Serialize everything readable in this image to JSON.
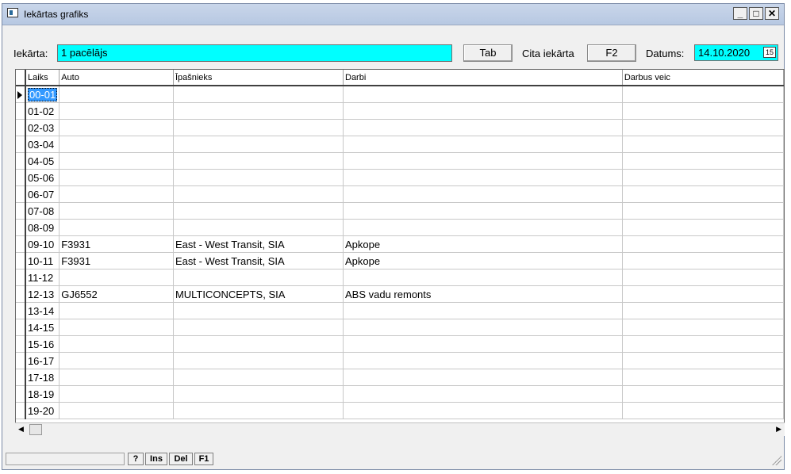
{
  "window": {
    "title": "Iekārtas grafiks",
    "controls": [
      "_",
      "□",
      "✕"
    ]
  },
  "header": {
    "iekarta_label": "Iekārta:",
    "iekarta_value": "1 pacēlājs",
    "tab_button": "Tab",
    "cita_label": "Cita iekārta",
    "f2_button": "F2",
    "datums_label": "Datums:",
    "datums_value": "14.10.2020"
  },
  "grid": {
    "columns": [
      "Laiks",
      "Auto",
      "Īpašnieks",
      "Darbi",
      "Darbus veic"
    ],
    "rows": [
      [
        "00-01",
        "",
        "",
        "",
        ""
      ],
      [
        "01-02",
        "",
        "",
        "",
        ""
      ],
      [
        "02-03",
        "",
        "",
        "",
        ""
      ],
      [
        "03-04",
        "",
        "",
        "",
        ""
      ],
      [
        "04-05",
        "",
        "",
        "",
        ""
      ],
      [
        "05-06",
        "",
        "",
        "",
        ""
      ],
      [
        "06-07",
        "",
        "",
        "",
        ""
      ],
      [
        "07-08",
        "",
        "",
        "",
        ""
      ],
      [
        "08-09",
        "",
        "",
        "",
        ""
      ],
      [
        "09-10",
        "F3931",
        "East - West Transit, SIA",
        "Apkope",
        ""
      ],
      [
        "10-11",
        "F3931",
        "East - West Transit, SIA",
        "Apkope",
        ""
      ],
      [
        "11-12",
        "",
        "",
        "",
        ""
      ],
      [
        "12-13",
        "GJ6552",
        "MULTICONCEPTS, SIA",
        "ABS vadu remonts",
        ""
      ],
      [
        "13-14",
        "",
        "",
        "",
        ""
      ],
      [
        "14-15",
        "",
        "",
        "",
        ""
      ],
      [
        "15-16",
        "",
        "",
        "",
        ""
      ],
      [
        "16-17",
        "",
        "",
        "",
        ""
      ],
      [
        "17-18",
        "",
        "",
        "",
        ""
      ],
      [
        "18-19",
        "",
        "",
        "",
        ""
      ],
      [
        "19-20",
        "",
        "",
        "",
        ""
      ]
    ]
  },
  "statusbar": {
    "buttons": [
      "?",
      "Ins",
      "Del",
      "F1"
    ]
  }
}
